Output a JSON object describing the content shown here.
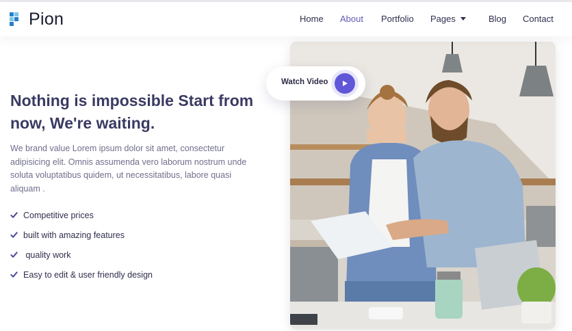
{
  "brand": {
    "name": "Pion",
    "colors": {
      "mark_primary": "#2a7fc8",
      "mark_secondary": "#7cc4ea",
      "accent": "#5f57d8"
    }
  },
  "nav": {
    "items": [
      {
        "label": "Home",
        "active": false
      },
      {
        "label": "About",
        "active": true
      },
      {
        "label": "Portfolio",
        "active": false
      },
      {
        "label": "Pages",
        "active": false,
        "has_dropdown": true
      },
      {
        "label": "Blog",
        "active": false
      },
      {
        "label": "Contact",
        "active": false
      }
    ]
  },
  "hero": {
    "title": "Nothing is impossible Start from now, We're waiting.",
    "description": "We brand value Lorem ipsum dolor sit amet, consectetur adipisicing elit. Omnis assumenda vero laborum nostrum unde soluta voluptatibus quidem, ut necessitatibus, labore quasi aliquam .",
    "features": [
      "Competitive prices",
      "built with amazing features",
      " quality work",
      "Easy to edit & user friendly design"
    ],
    "video": {
      "label": "Watch Video",
      "icon": "play-icon"
    },
    "image": {
      "icon": "photo-two-people-working"
    }
  }
}
